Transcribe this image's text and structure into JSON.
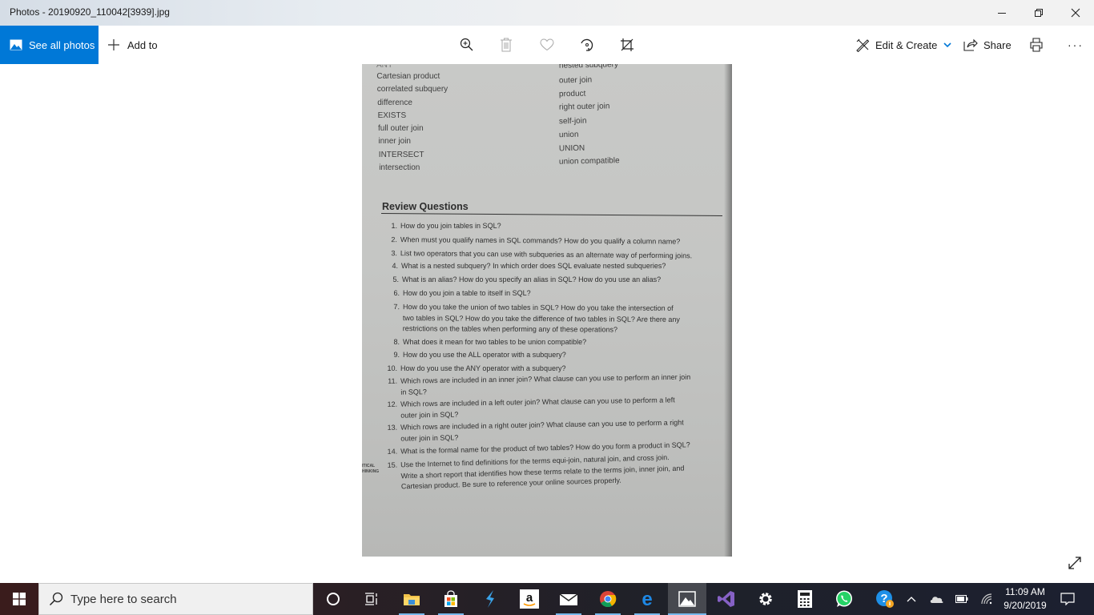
{
  "window": {
    "title": "Photos - 20190920_110042[3939].jpg",
    "controls": {
      "minimize": "minimize",
      "restore": "restore",
      "close": "close"
    }
  },
  "toolbar": {
    "see_all_photos": "See all photos",
    "add_to": "Add to",
    "center_icons": [
      "zoom-in-icon",
      "delete-icon",
      "favorite-icon",
      "rotate-icon",
      "crop-icon"
    ],
    "edit_create": "Edit & Create",
    "share": "Share",
    "print": "print-icon",
    "more": "···"
  },
  "photo": {
    "key_terms_left": [
      "ANY",
      "Cartesian product",
      "correlated subquery",
      "difference",
      "EXISTS",
      "full outer join",
      "inner join",
      "INTERSECT",
      "intersection"
    ],
    "key_terms_right": [
      "nested subquery",
      "outer join",
      "product",
      "right outer join",
      "self-join",
      "union",
      "UNION",
      "union compatible"
    ],
    "section_title": "Review Questions",
    "questions": [
      {
        "num": "1.",
        "lines": [
          "How do you join tables in SQL?"
        ]
      },
      {
        "num": "2.",
        "lines": [
          "When must you qualify names in SQL commands? How do you qualify a column name?"
        ]
      },
      {
        "num": "3.",
        "lines": [
          "List two operators that you can use with subqueries as an alternate way of performing joins."
        ]
      },
      {
        "num": "4.",
        "lines": [
          "What is a nested subquery? In which order does SQL evaluate nested subqueries?"
        ]
      },
      {
        "num": "5.",
        "lines": [
          "What is an alias? How do you specify an alias in SQL? How do you use an alias?"
        ]
      },
      {
        "num": "6.",
        "lines": [
          "How do you join a table to itself in SQL?"
        ]
      },
      {
        "num": "7.",
        "lines": [
          "How do you take the union of two tables in SQL? How do you take the intersection of",
          "two tables in SQL? How do you take the difference of two tables in SQL? Are there any",
          "restrictions on the tables when performing any of these operations?"
        ]
      },
      {
        "num": "8.",
        "lines": [
          "What does it mean for two tables to be union compatible?"
        ]
      },
      {
        "num": "9.",
        "lines": [
          "How do you use the ALL operator with a subquery?"
        ]
      },
      {
        "num": "10.",
        "lines": [
          "How do you use the ANY operator with a subquery?"
        ]
      },
      {
        "num": "11.",
        "lines": [
          "Which rows are included in an inner join? What clause can you use to perform an inner join",
          "in SQL?"
        ]
      },
      {
        "num": "12.",
        "lines": [
          "Which rows are included in a left outer join? What clause can you use to perform a left",
          "outer join in SQL?"
        ]
      },
      {
        "num": "13.",
        "lines": [
          "Which rows are included in a right outer join? What clause can you use to perform a right",
          "outer join in SQL?"
        ]
      },
      {
        "num": "14.",
        "lines": [
          "What is the formal name for the product of two tables? How do you form a product in SQL?"
        ]
      },
      {
        "num": "15.",
        "lines": [
          "Use the Internet to find definitions for the terms equi-join, natural join, and cross join.",
          "Write a short report that identifies how these terms relate to the terms join, inner join, and",
          "Cartesian product. Be sure to reference your online sources properly."
        ]
      }
    ],
    "margin_note": [
      "ITICAL",
      "HINKING"
    ]
  },
  "taskbar": {
    "search_placeholder": "Type here to search",
    "apps": [
      "cortana",
      "task-view",
      "file-explorer",
      "microsoft-store",
      "app-launcher",
      "amazon",
      "mail",
      "chrome",
      "edge",
      "photos",
      "visual-studio",
      "settings",
      "calculator",
      "whatsapp",
      "help"
    ],
    "clock_time": "11:09 AM",
    "clock_date": "9/20/2019"
  }
}
